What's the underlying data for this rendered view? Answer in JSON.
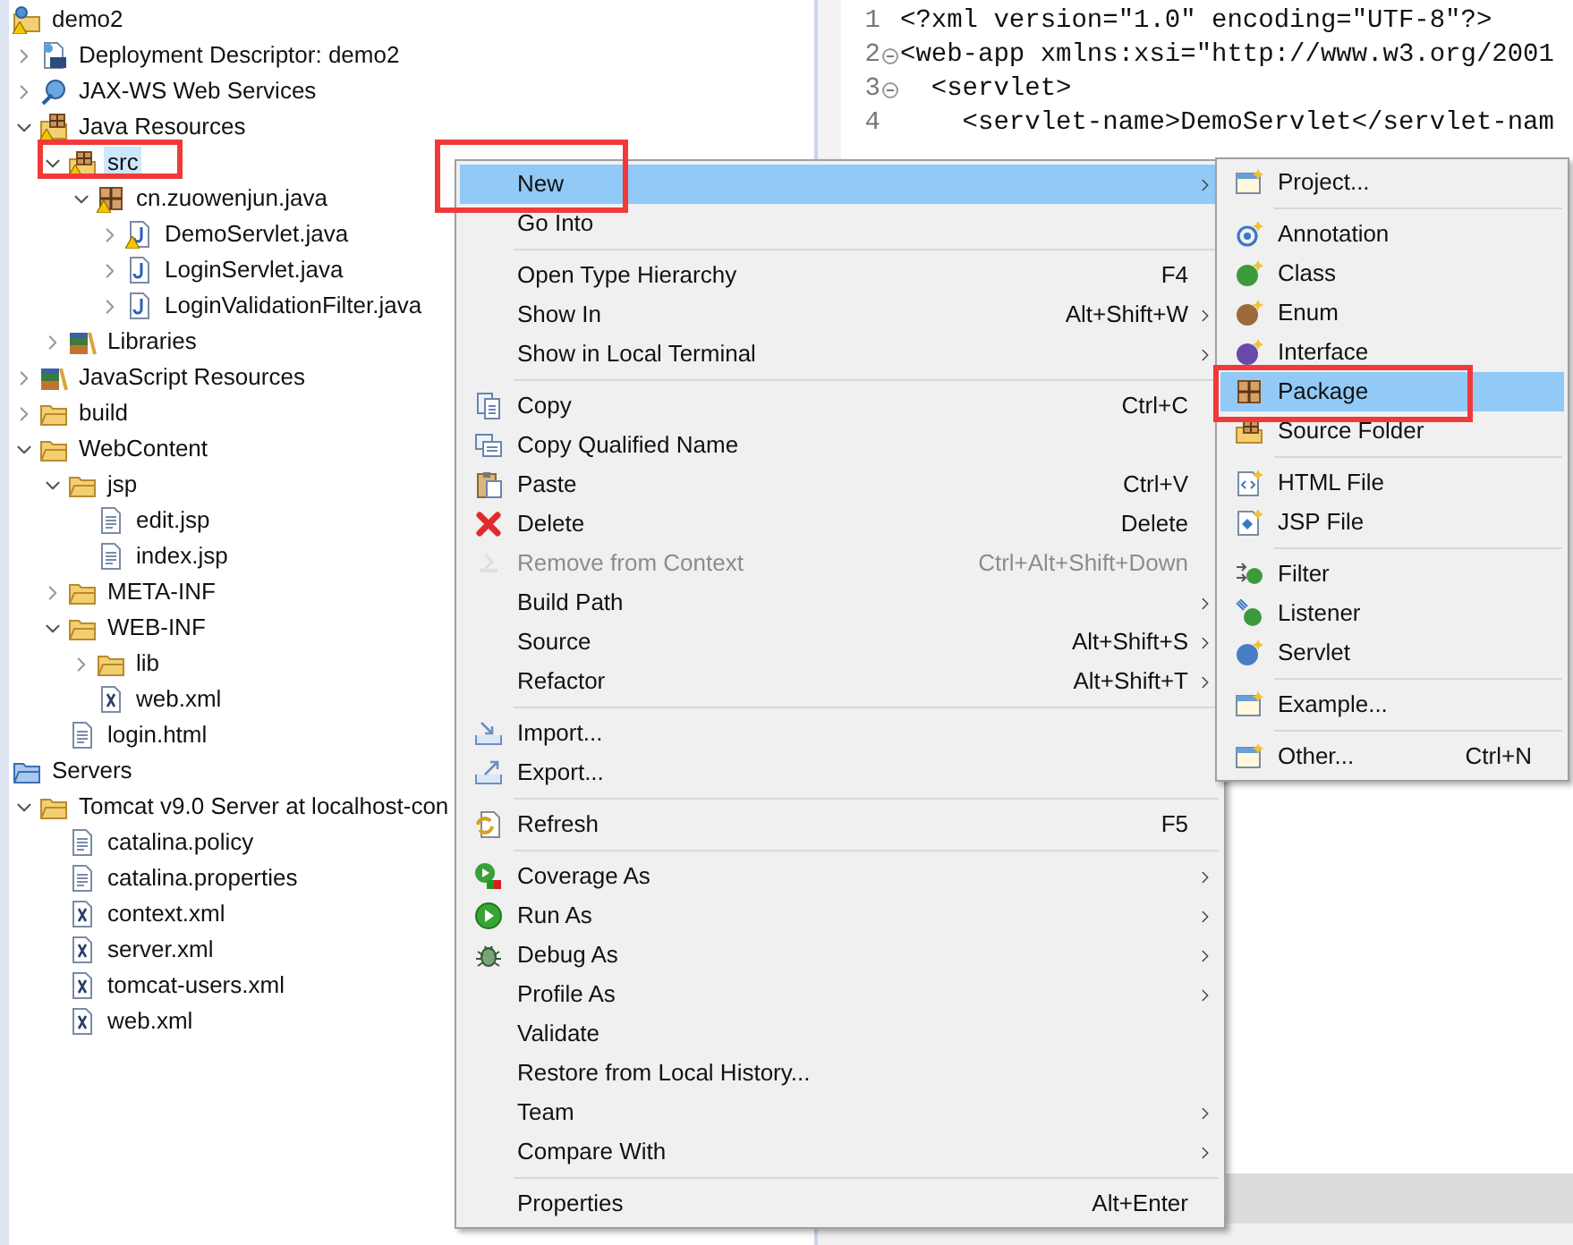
{
  "tree": [
    {
      "label": "demo2",
      "kind": "project",
      "warning": true,
      "selected": false,
      "marked": false,
      "children": [
        {
          "label": "Deployment Descriptor: demo2",
          "kind": "descriptor",
          "warning": false,
          "expanded": false,
          "selected": false,
          "marked": false
        },
        {
          "label": "JAX-WS Web Services",
          "kind": "webservices",
          "warning": false,
          "expanded": false,
          "selected": false,
          "marked": false
        },
        {
          "label": "Java Resources",
          "kind": "javares",
          "warning": true,
          "expanded": true,
          "selected": false,
          "marked": false,
          "children": [
            {
              "label": "src",
              "kind": "srcfolder",
              "warning": true,
              "expanded": true,
              "selected": true,
              "marked": true,
              "children": [
                {
                  "label": "cn.zuowenjun.java",
                  "kind": "package",
                  "warning": true,
                  "expanded": true,
                  "selected": false,
                  "marked": false,
                  "children": [
                    {
                      "label": "DemoServlet.java",
                      "kind": "javafile",
                      "warning": true,
                      "expanded": false,
                      "selected": false,
                      "marked": false
                    },
                    {
                      "label": "LoginServlet.java",
                      "kind": "javafile",
                      "warning": false,
                      "expanded": false,
                      "selected": false,
                      "marked": false
                    },
                    {
                      "label": "LoginValidationFilter.java",
                      "kind": "javafile",
                      "warning": false,
                      "expanded": false,
                      "selected": false,
                      "marked": false
                    }
                  ]
                }
              ]
            },
            {
              "label": "Libraries",
              "kind": "libraries",
              "warning": false,
              "expanded": false,
              "selected": false,
              "marked": false
            }
          ]
        },
        {
          "label": "JavaScript Resources",
          "kind": "libraries",
          "warning": false,
          "expanded": false,
          "selected": false,
          "marked": false
        },
        {
          "label": "build",
          "kind": "folder",
          "warning": false,
          "expanded": false,
          "selected": false,
          "marked": false
        },
        {
          "label": "WebContent",
          "kind": "folder",
          "warning": false,
          "expanded": true,
          "selected": false,
          "marked": false,
          "children": [
            {
              "label": "jsp",
              "kind": "folder",
              "warning": false,
              "expanded": true,
              "selected": false,
              "marked": false,
              "children": [
                {
                  "label": "edit.jsp",
                  "kind": "textfile",
                  "warning": false,
                  "selected": false,
                  "marked": false
                },
                {
                  "label": "index.jsp",
                  "kind": "textfile",
                  "warning": false,
                  "selected": false,
                  "marked": false
                }
              ]
            },
            {
              "label": "META-INF",
              "kind": "folder",
              "warning": false,
              "expanded": false,
              "selected": false,
              "marked": false
            },
            {
              "label": "WEB-INF",
              "kind": "folder",
              "warning": false,
              "expanded": true,
              "selected": false,
              "marked": false,
              "children": [
                {
                  "label": "lib",
                  "kind": "folder",
                  "warning": false,
                  "expanded": false,
                  "selected": false,
                  "marked": false
                },
                {
                  "label": "web.xml",
                  "kind": "xmlfile",
                  "warning": false,
                  "selected": false,
                  "marked": false
                }
              ]
            },
            {
              "label": "login.html",
              "kind": "textfile",
              "warning": false,
              "selected": false,
              "marked": false
            }
          ]
        }
      ]
    },
    {
      "label": "Servers",
      "kind": "servers",
      "warning": false,
      "selected": false,
      "marked": false,
      "children": [
        {
          "label": "Tomcat v9.0 Server at localhost-con",
          "kind": "folder",
          "warning": false,
          "expanded": true,
          "selected": false,
          "marked": false,
          "children": [
            {
              "label": "catalina.policy",
              "kind": "textfile",
              "warning": false,
              "selected": false,
              "marked": false
            },
            {
              "label": "catalina.properties",
              "kind": "textfile",
              "warning": false,
              "selected": false,
              "marked": false
            },
            {
              "label": "context.xml",
              "kind": "xmlfile",
              "warning": false,
              "selected": false,
              "marked": false
            },
            {
              "label": "server.xml",
              "kind": "xmlfile",
              "warning": false,
              "selected": false,
              "marked": false
            },
            {
              "label": "tomcat-users.xml",
              "kind": "xmlfile",
              "warning": false,
              "selected": false,
              "marked": false
            },
            {
              "label": "web.xml",
              "kind": "xmlfile",
              "warning": false,
              "selected": false,
              "marked": false
            }
          ]
        }
      ]
    }
  ],
  "editor": {
    "lines": [
      {
        "number": "1",
        "text": "<?xml version=\"1.0\" encoding=\"UTF-8\"?>",
        "foldable": false
      },
      {
        "number": "2",
        "text": "<web-app xmlns:xsi=\"http://www.w3.org/2001",
        "foldable": true
      },
      {
        "number": "3",
        "text": "  <servlet>",
        "foldable": true
      },
      {
        "number": "4",
        "text": "    <servlet-name>DemoServlet</servlet-nam",
        "foldable": false
      }
    ]
  },
  "context_menu": {
    "groups": [
      [
        {
          "label": "New",
          "kind": "plain",
          "submenu": true,
          "disabled": false,
          "selected": true,
          "marked": true
        },
        {
          "label": "Go Into",
          "kind": "plain",
          "submenu": false,
          "disabled": false,
          "selected": false,
          "marked": false
        }
      ],
      [
        {
          "label": "Open Type Hierarchy",
          "kind": "plain",
          "shortcut": "F4",
          "submenu": false,
          "disabled": false,
          "selected": false,
          "marked": false
        },
        {
          "label": "Show In",
          "kind": "plain",
          "shortcut": "Alt+Shift+W",
          "submenu": true,
          "disabled": false,
          "selected": false,
          "marked": false
        },
        {
          "label": "Show in Local Terminal",
          "kind": "plain",
          "submenu": true,
          "disabled": false,
          "selected": false,
          "marked": false
        }
      ],
      [
        {
          "label": "Copy",
          "kind": "copy",
          "shortcut": "Ctrl+C",
          "submenu": false,
          "disabled": false,
          "selected": false,
          "marked": false
        },
        {
          "label": "Copy Qualified Name",
          "kind": "copyname",
          "submenu": false,
          "disabled": false,
          "selected": false,
          "marked": false
        },
        {
          "label": "Paste",
          "kind": "paste",
          "shortcut": "Ctrl+V",
          "submenu": false,
          "disabled": false,
          "selected": false,
          "marked": false
        },
        {
          "label": "Delete",
          "kind": "delete",
          "shortcut": "Delete",
          "submenu": false,
          "disabled": false,
          "selected": false,
          "marked": false
        },
        {
          "label": "Remove from Context",
          "kind": "remove",
          "shortcut": "Ctrl+Alt+Shift+Down",
          "submenu": false,
          "disabled": true,
          "selected": false,
          "marked": false
        },
        {
          "label": "Build Path",
          "kind": "plain",
          "submenu": true,
          "disabled": false,
          "selected": false,
          "marked": false
        },
        {
          "label": "Source",
          "kind": "plain",
          "shortcut": "Alt+Shift+S",
          "submenu": true,
          "disabled": false,
          "selected": false,
          "marked": false
        },
        {
          "label": "Refactor",
          "kind": "plain",
          "shortcut": "Alt+Shift+T",
          "submenu": true,
          "disabled": false,
          "selected": false,
          "marked": false
        }
      ],
      [
        {
          "label": "Import...",
          "kind": "import",
          "submenu": false,
          "disabled": false,
          "selected": false,
          "marked": false
        },
        {
          "label": "Export...",
          "kind": "export",
          "submenu": false,
          "disabled": false,
          "selected": false,
          "marked": false
        }
      ],
      [
        {
          "label": "Refresh",
          "kind": "refresh",
          "shortcut": "F5",
          "submenu": false,
          "disabled": false,
          "selected": false,
          "marked": false
        }
      ],
      [
        {
          "label": "Coverage As",
          "kind": "coverage",
          "submenu": true,
          "disabled": false,
          "selected": false,
          "marked": false
        },
        {
          "label": "Run As",
          "kind": "run",
          "submenu": true,
          "disabled": false,
          "selected": false,
          "marked": false
        },
        {
          "label": "Debug As",
          "kind": "debug",
          "submenu": true,
          "disabled": false,
          "selected": false,
          "marked": false
        },
        {
          "label": "Profile As",
          "kind": "plain",
          "submenu": true,
          "disabled": false,
          "selected": false,
          "marked": false
        },
        {
          "label": "Validate",
          "kind": "plain",
          "submenu": false,
          "disabled": false,
          "selected": false,
          "marked": false
        },
        {
          "label": "Restore from Local History...",
          "kind": "plain",
          "submenu": false,
          "disabled": false,
          "selected": false,
          "marked": false
        },
        {
          "label": "Team",
          "kind": "plain",
          "submenu": true,
          "disabled": false,
          "selected": false,
          "marked": false
        },
        {
          "label": "Compare With",
          "kind": "plain",
          "submenu": true,
          "disabled": false,
          "selected": false,
          "marked": false
        }
      ],
      [
        {
          "label": "Properties",
          "kind": "plain",
          "shortcut": "Alt+Enter",
          "submenu": false,
          "disabled": false,
          "selected": false,
          "marked": false
        }
      ]
    ]
  },
  "submenu": {
    "groups": [
      [
        {
          "label": "Project...",
          "kind": "window",
          "selected": false,
          "marked": false
        }
      ],
      [
        {
          "label": "Annotation",
          "kind": "annotation",
          "selected": false,
          "marked": false
        },
        {
          "label": "Class",
          "kind": "class",
          "selected": false,
          "marked": false
        },
        {
          "label": "Enum",
          "kind": "enum",
          "selected": false,
          "marked": false
        },
        {
          "label": "Interface",
          "kind": "interface",
          "selected": false,
          "marked": false
        },
        {
          "label": "Package",
          "kind": "package",
          "selected": true,
          "marked": true
        },
        {
          "label": "Source Folder",
          "kind": "srcfolder",
          "selected": false,
          "marked": false
        }
      ],
      [
        {
          "label": "HTML File",
          "kind": "html",
          "selected": false,
          "marked": false
        },
        {
          "label": "JSP File",
          "kind": "jsp",
          "selected": false,
          "marked": false
        }
      ],
      [
        {
          "label": "Filter",
          "kind": "filter",
          "selected": false,
          "marked": false
        },
        {
          "label": "Listener",
          "kind": "listener",
          "selected": false,
          "marked": false
        },
        {
          "label": "Servlet",
          "kind": "servlet",
          "selected": false,
          "marked": false
        }
      ],
      [
        {
          "label": "Example...",
          "kind": "window",
          "selected": false,
          "marked": false
        }
      ],
      [
        {
          "label": "Other...",
          "kind": "window",
          "shortcut": "Ctrl+N",
          "selected": false,
          "marked": false
        }
      ]
    ]
  }
}
